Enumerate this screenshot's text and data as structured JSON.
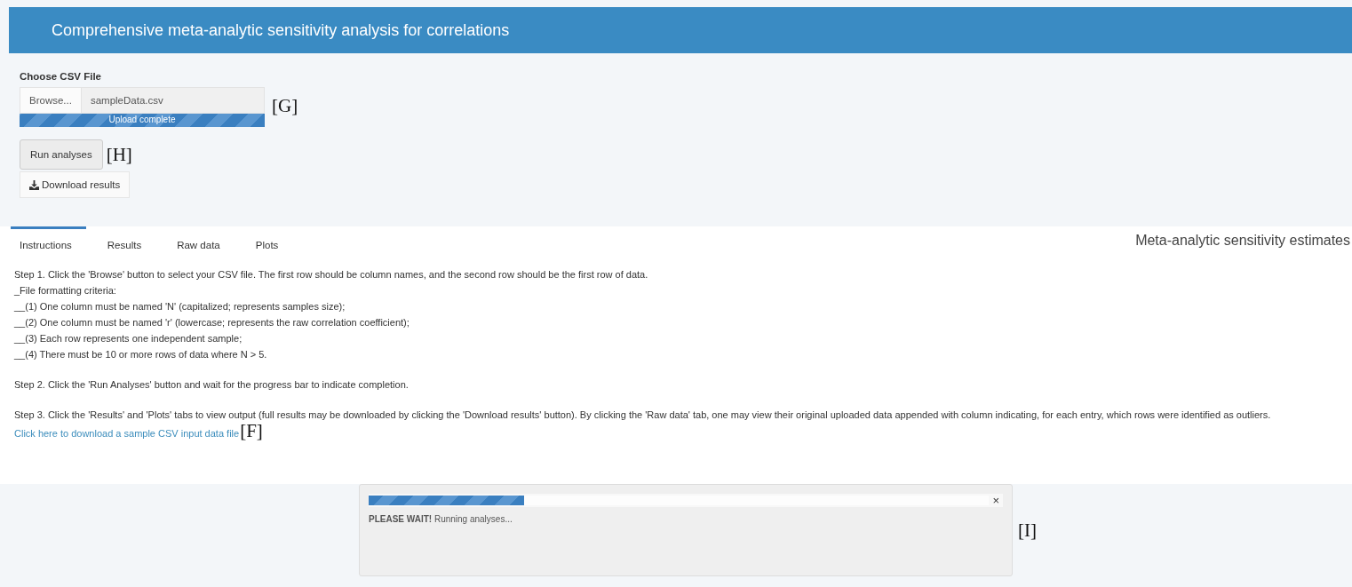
{
  "header": {
    "title": "Comprehensive meta-analytic sensitivity analysis for correlations"
  },
  "file_input": {
    "label": "Choose CSV File",
    "button": "Browse...",
    "filename": "sampleData.csv",
    "upload": {
      "level": 1,
      "text": "Upload complete"
    },
    "callout": "[G]"
  },
  "run_button": {
    "label": "Run analyses",
    "callout": "[H]"
  },
  "download_button": {
    "label": "Download results"
  },
  "tabs": [
    {
      "label": "Instructions",
      "selected": true
    },
    {
      "label": "Results",
      "selected": false
    },
    {
      "label": "Raw data",
      "selected": false
    },
    {
      "label": "Plots",
      "selected": false
    }
  ],
  "panel_title": "Meta-analytic sensitivity estimates",
  "instructions": {
    "step1": [
      "Step 1. Click the 'Browse' button to select your CSV file. The first row should be column names, and the second row should be the first row of data.",
      "_File formatting criteria:",
      "__(1) One column must be named 'N' (capitalized; represents samples size);",
      "__(2) One column must be named 'r' (lowercase; represents the raw correlation coefficient);",
      "__(3) Each row represents one independent sample;",
      "__(4) There must be 10 or more rows of data where N > 5."
    ],
    "step2": "Step 2. Click the 'Run Analyses' button and wait for the progress bar to indicate completion.",
    "step3": "Step 3. Click the 'Results' and 'Plots' tabs to view output (full results may be downloaded by clicking the 'Download results' button). By clicking the 'Raw data' tab, one may view their original uploaded data appended with column indicating, for each entry, which rows were identified as outliers.",
    "link": "Click here to download a sample CSV input data file",
    "callout": "[F]"
  },
  "progress_dialog": {
    "level": 0.25,
    "title": "PLEASE WAIT!",
    "message": "Running analyses...",
    "close": "×",
    "callout": "[I]"
  }
}
